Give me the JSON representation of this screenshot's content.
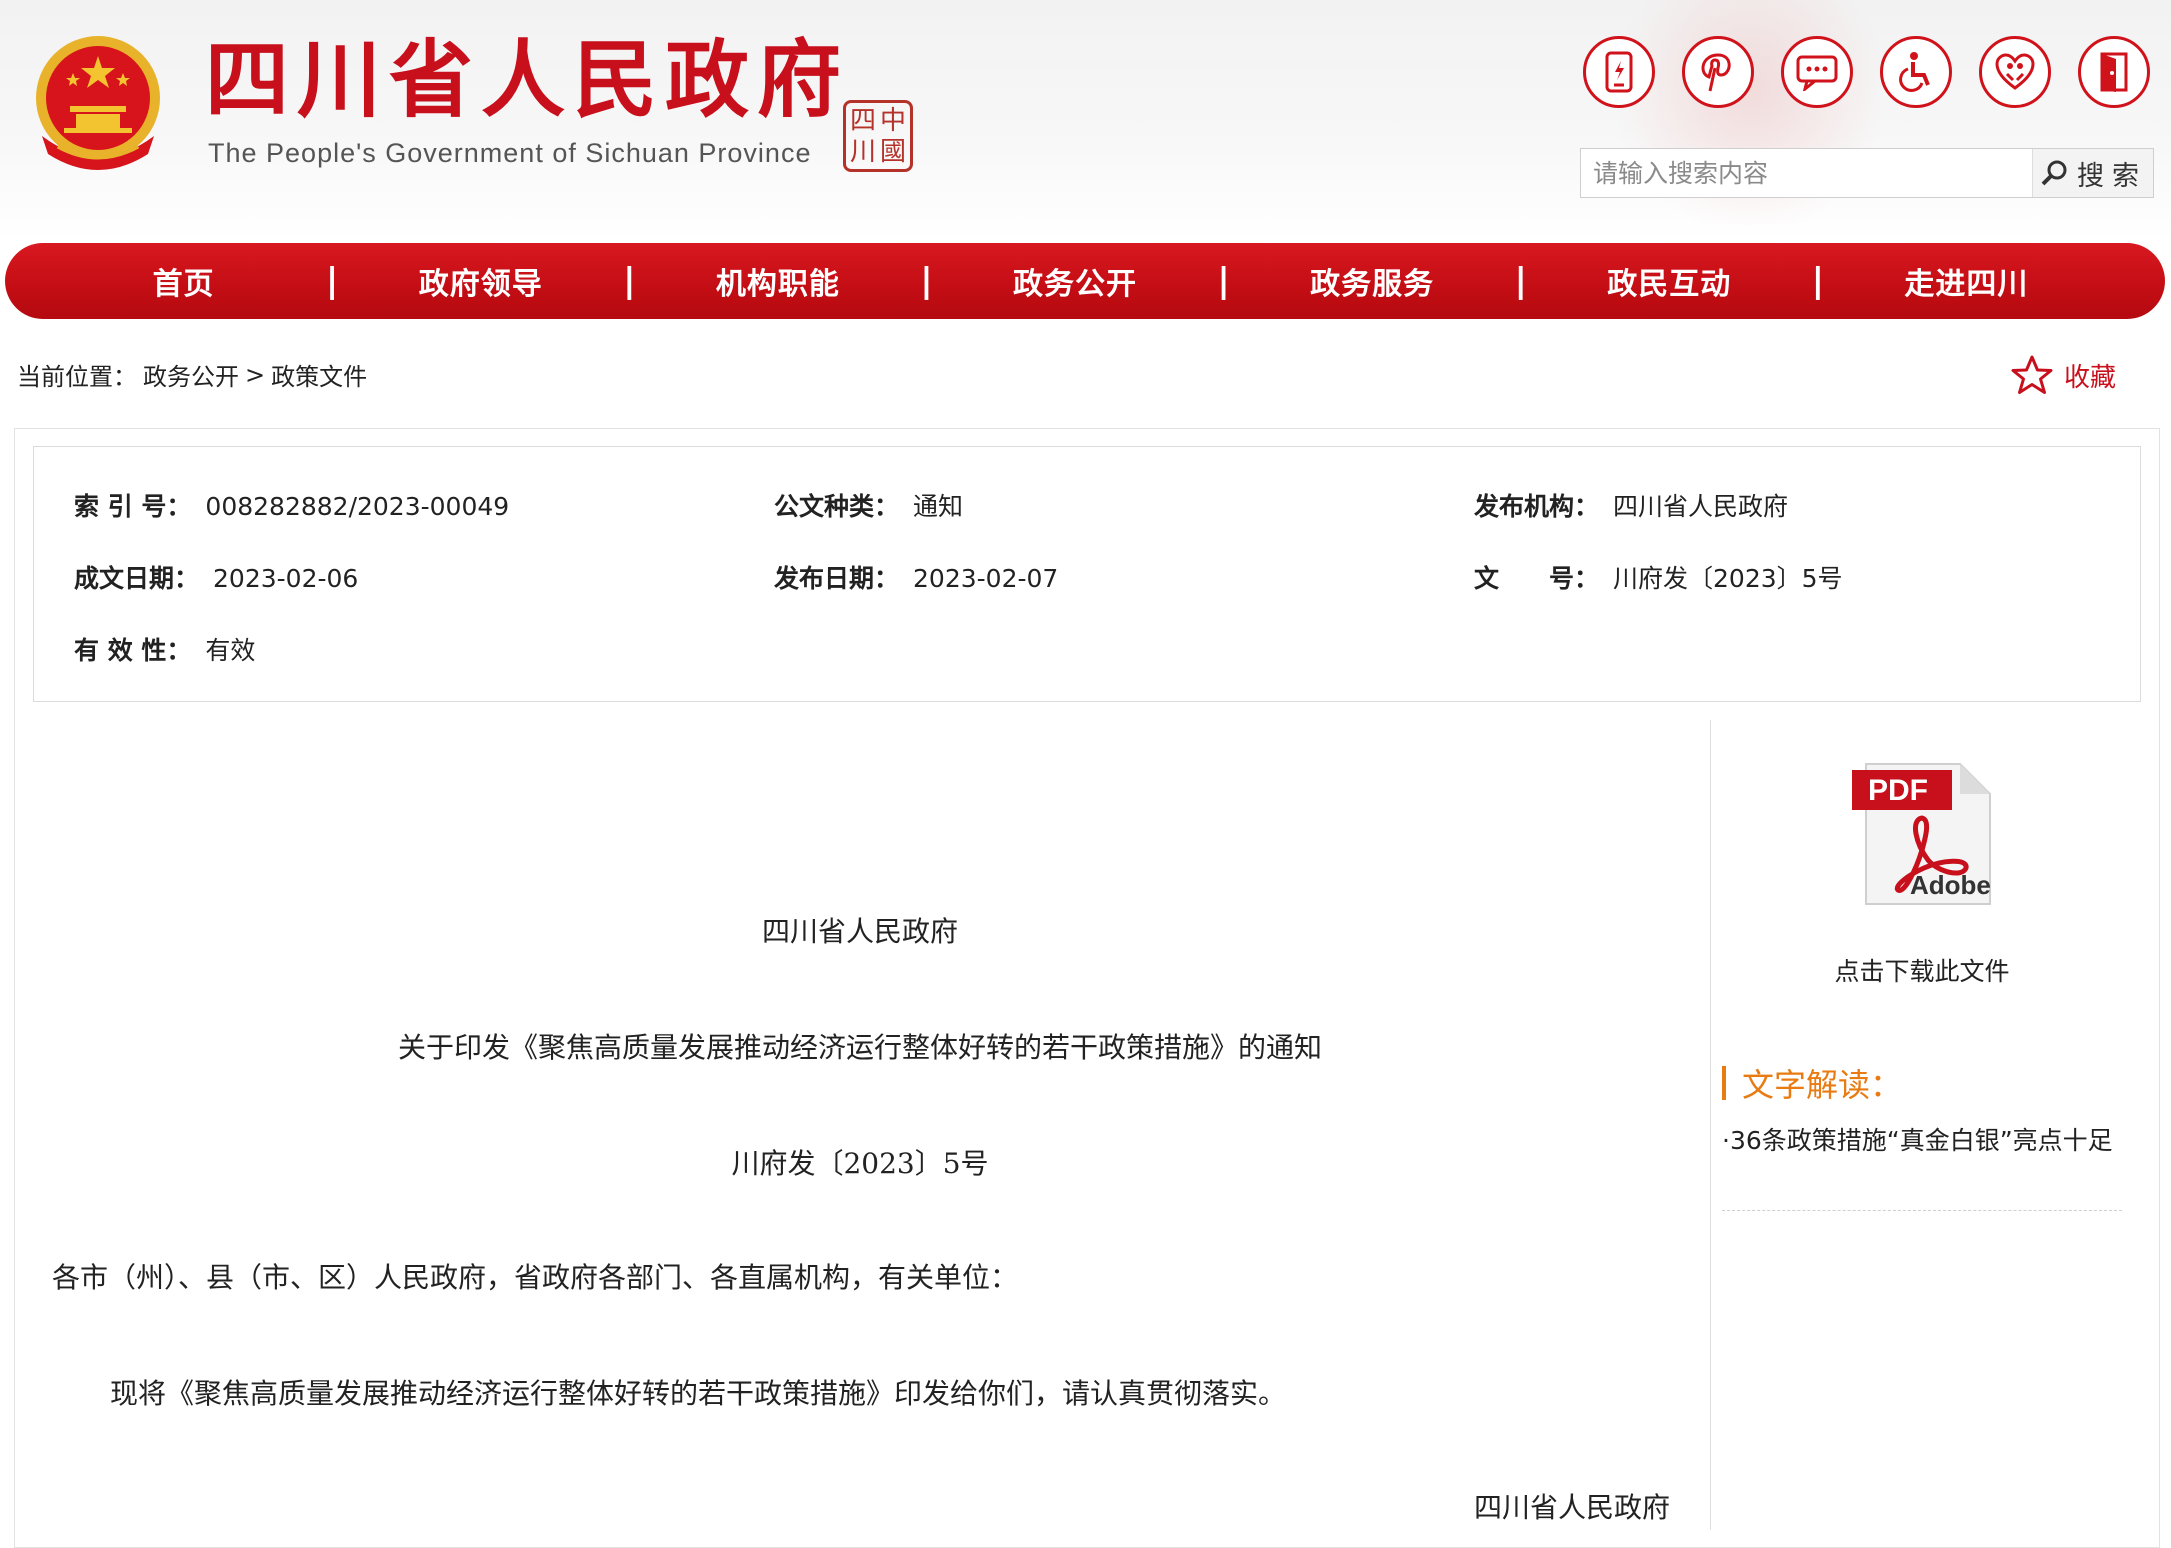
{
  "header": {
    "site_title": "四川省人民政府",
    "site_subtitle": "The People's Government of Sichuan Province",
    "seal_chars": [
      "四",
      "中",
      "川",
      "國"
    ],
    "icons": [
      "mobile-icon",
      "pinterest-icon",
      "message-icon",
      "accessibility-icon",
      "elderly-care-icon",
      "exit-icon"
    ],
    "search": {
      "placeholder": "请输入搜索内容",
      "button_label": "搜索"
    },
    "brand_color": "#c8101d"
  },
  "nav": {
    "items": [
      "首页",
      "政府领导",
      "机构职能",
      "政务公开",
      "政务服务",
      "政民互动",
      "走进四川"
    ],
    "separator": "|"
  },
  "breadcrumb": {
    "prefix": "当前位置：",
    "items": [
      "政务公开",
      "政策文件"
    ],
    "separator": ">"
  },
  "favorite": {
    "label": "收藏"
  },
  "info": {
    "index_label": "索 引 号：",
    "index_value": "008282882/2023-00049",
    "category_label": "公文种类：",
    "category_value": "通知",
    "issuer_label": "发布机构：",
    "issuer_value": "四川省人民政府",
    "created_label": "成文日期：",
    "created_value": "2023-02-06",
    "published_label": "发布日期：",
    "published_value": "2023-02-07",
    "docno_label": "文　　号：",
    "docno_value": "川府发〔2023〕5号",
    "validity_label": "有 效 性：",
    "validity_value": "有效"
  },
  "document": {
    "issuer": "四川省人民政府",
    "title": "关于印发《聚焦高质量发展推动经济运行整体好转的若干政策措施》的通知",
    "doc_number": "川府发〔2023〕5号",
    "salutation": "各市（州）、县（市、区）人民政府，省政府各部门、各直属机构，有关单位：",
    "body": "现将《聚焦高质量发展推动经济运行整体好转的若干政策措施》印发给你们，请认真贯彻落实。",
    "signature": "四川省人民政府"
  },
  "side": {
    "pdf_badge": "PDF",
    "pdf_brand": "Adobe",
    "download_label": "点击下载此文件",
    "interpretation_title": "文字解读：",
    "interpretation_link": "·36条政策措施“真金白银”亮点十足"
  }
}
